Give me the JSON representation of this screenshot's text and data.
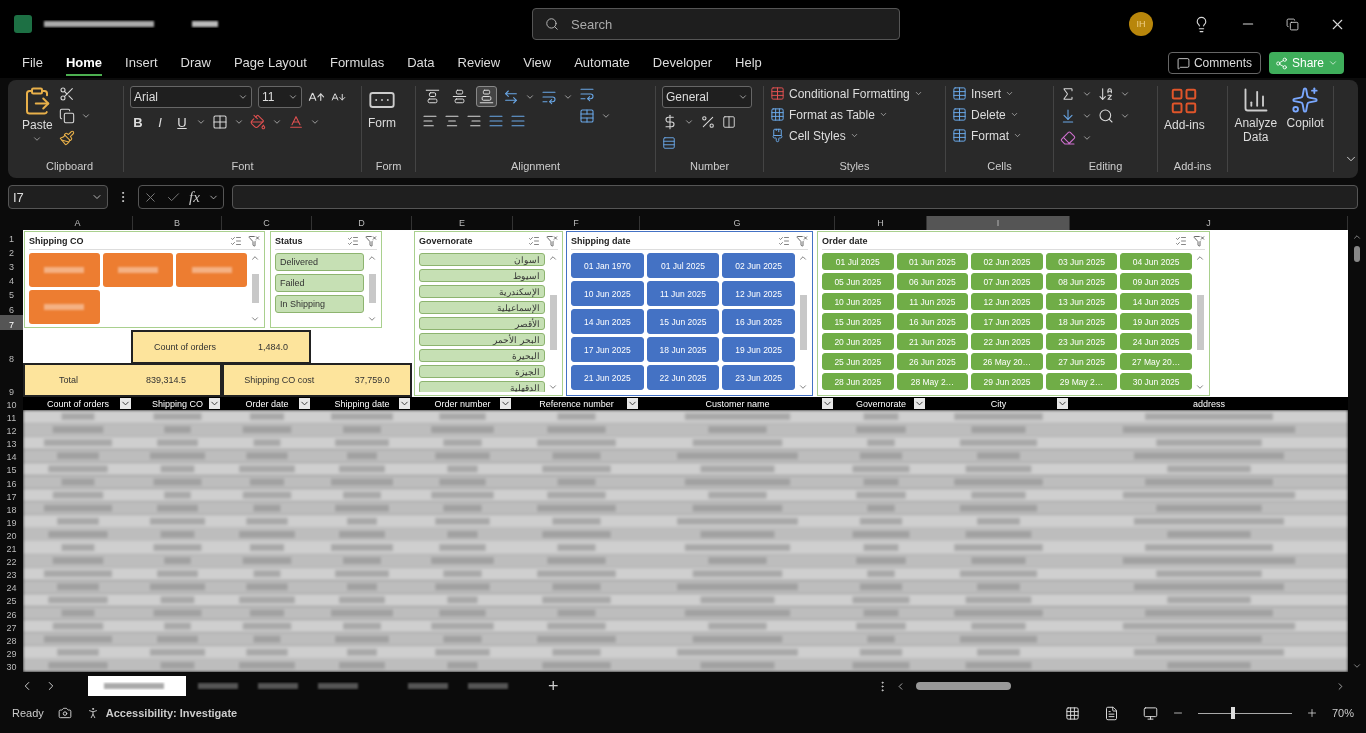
{
  "title_bar": {
    "search_placeholder": "Search",
    "avatar": "IH"
  },
  "menu_tabs": [
    {
      "label": "File",
      "selected": false
    },
    {
      "label": "Home",
      "selected": true
    },
    {
      "label": "Insert",
      "selected": false
    },
    {
      "label": "Draw",
      "selected": false
    },
    {
      "label": "Page Layout",
      "selected": false
    },
    {
      "label": "Formulas",
      "selected": false
    },
    {
      "label": "Data",
      "selected": false
    },
    {
      "label": "Review",
      "selected": false
    },
    {
      "label": "View",
      "selected": false
    },
    {
      "label": "Automate",
      "selected": false
    },
    {
      "label": "Developer",
      "selected": false
    },
    {
      "label": "Help",
      "selected": false
    }
  ],
  "comments": "Comments",
  "share": "Share",
  "ribbon": {
    "clipboard": {
      "label": "Clipboard",
      "paste": "Paste"
    },
    "font": {
      "label": "Font",
      "font_name": "Arial",
      "font_size": "11",
      "bold": "B",
      "italic": "I",
      "underline": "U"
    },
    "form": {
      "label": "Form",
      "button": "Form"
    },
    "alignment": {
      "label": "Alignment",
      "vertical": [
        {
          "selected": false
        },
        {
          "selected": false
        },
        {
          "selected": true
        }
      ]
    },
    "number": {
      "label": "Number",
      "format": "General"
    },
    "styles": {
      "label": "Styles",
      "items": [
        "Conditional Formatting",
        "Format as Table",
        "Cell Styles"
      ]
    },
    "cells": {
      "label": "Cells",
      "items": [
        "Insert",
        "Delete",
        "Format"
      ]
    },
    "editing": {
      "label": "Editing"
    },
    "addins": {
      "label": "Add-ins",
      "button": "Add-ins"
    },
    "analysis": {
      "buttons": [
        "Analyze Data",
        "Copilot"
      ]
    }
  },
  "formula_bar": {
    "name_box": "I7",
    "fx": "fx"
  },
  "sheet": {
    "columns": [
      {
        "label": "A",
        "selected": false
      },
      {
        "label": "B",
        "selected": false
      },
      {
        "label": "C",
        "selected": false
      },
      {
        "label": "D",
        "selected": false
      },
      {
        "label": "E",
        "selected": false
      },
      {
        "label": "F",
        "selected": false
      },
      {
        "label": "G",
        "selected": false
      },
      {
        "label": "H",
        "selected": false
      },
      {
        "label": "I",
        "selected": true
      },
      {
        "label": "J",
        "selected": false
      }
    ],
    "rows": [
      {
        "label": "1",
        "selected": false
      },
      {
        "label": "2",
        "selected": false
      },
      {
        "label": "3",
        "selected": false
      },
      {
        "label": "4",
        "selected": false
      },
      {
        "label": "5",
        "selected": false
      },
      {
        "label": "6",
        "selected": false
      },
      {
        "label": "7",
        "selected": true
      },
      {
        "label": "8",
        "selected": false
      },
      {
        "label": "9",
        "selected": false
      },
      {
        "label": "10",
        "selected": false
      },
      {
        "label": "11",
        "selected": false
      },
      {
        "label": "12",
        "selected": false
      },
      {
        "label": "13",
        "selected": false
      },
      {
        "label": "14",
        "selected": false
      },
      {
        "label": "15",
        "selected": false
      },
      {
        "label": "16",
        "selected": false
      },
      {
        "label": "17",
        "selected": false
      },
      {
        "label": "18",
        "selected": false
      },
      {
        "label": "19",
        "selected": false
      },
      {
        "label": "20",
        "selected": false
      },
      {
        "label": "21",
        "selected": false
      },
      {
        "label": "22",
        "selected": false
      },
      {
        "label": "23",
        "selected": false
      },
      {
        "label": "24",
        "selected": false
      },
      {
        "label": "25",
        "selected": false
      },
      {
        "label": "26",
        "selected": false
      },
      {
        "label": "27",
        "selected": false
      },
      {
        "label": "28",
        "selected": false
      },
      {
        "label": "29",
        "selected": false
      },
      {
        "label": "30",
        "selected": false
      }
    ],
    "slicers": [
      {
        "title": "Shipping CO",
        "kind": "redacted",
        "color": "#ed7d31"
      },
      {
        "title": "Status",
        "kind": "list",
        "color": "#c6e0b4",
        "items": [
          "Delivered",
          "Failed",
          "In Shipping"
        ]
      },
      {
        "title": "Governorate",
        "kind": "list",
        "color": "#c6e0b4",
        "items": [
          "اسوان",
          "اسيوط",
          "الإسكندرية",
          "الإسماعيلية",
          "الأقصر",
          "البحر الأحمر",
          "البحيرة",
          "الجيزة",
          "الدقهلية"
        ]
      },
      {
        "title": "Shipping date",
        "kind": "tiles",
        "color": "#4472c4",
        "items": [
          "01 Jan 1970",
          "01 Jul 2025",
          "02 Jun 2025",
          "10 Jun 2025",
          "11 Jun 2025",
          "12 Jun 2025",
          "14 Jun 2025",
          "15 Jun 2025",
          "16 Jun 2025",
          "17 Jun 2025",
          "18 Jun 2025",
          "19 Jun 2025",
          "21 Jun 2025",
          "22 Jun 2025",
          "23 Jun 2025"
        ]
      },
      {
        "title": "Order date",
        "kind": "tiles",
        "color": "#70ad47",
        "items": [
          "01 Jul 2025",
          "01 Jun 2025",
          "02 Jun 2025",
          "03 Jun 2025",
          "04 Jun 2025",
          "05 Jun 2025",
          "06 Jun 2025",
          "07 Jun 2025",
          "08 Jun 2025",
          "09 Jun 2025",
          "10 Jun 2025",
          "11 Jun 2025",
          "12 Jun 2025",
          "13 Jun 2025",
          "14 Jun 2025",
          "15 Jun 2025",
          "16 Jun 2025",
          "17 Jun 2025",
          "18 Jun 2025",
          "19 Jun 2025",
          "20 Jun 2025",
          "21 Jun 2025",
          "22 Jun 2025",
          "23 Jun 2025",
          "24 Jun 2025",
          "25 Jun 2025",
          "26 Jun 2025",
          "26 May 20…",
          "27 Jun 2025",
          "27 May 20…",
          "28 Jun 2025",
          "28 May 2…",
          "29 Jun 2025",
          "29 May 2…",
          "30 Jun 2025"
        ]
      }
    ],
    "summary": [
      {
        "label": "Count of orders",
        "value": "1,484.0"
      },
      {
        "label": "Total",
        "value": "839,314.5"
      },
      {
        "label": "Shipping CO cost",
        "value": "37,759.0"
      }
    ],
    "table_headers": [
      {
        "label": "Count of orders",
        "filter": true
      },
      {
        "label": "Shipping CO",
        "filter": true
      },
      {
        "label": "Order date",
        "filter": true
      },
      {
        "label": "Shipping date",
        "filter": true
      },
      {
        "label": "Order number",
        "filter": true
      },
      {
        "label": "Reference number",
        "filter": true
      },
      {
        "label": "Customer name",
        "filter": true
      },
      {
        "label": "Governorate",
        "filter": true
      },
      {
        "label": "City",
        "filter": true
      },
      {
        "label": "address",
        "filter": false
      }
    ]
  },
  "sheet_tabs": {
    "add": "+"
  },
  "status_bar": {
    "ready": "Ready",
    "accessibility": "Accessibility: Investigate",
    "zoom": "70%",
    "zoom_slider": {
      "level": 0.35
    }
  }
}
